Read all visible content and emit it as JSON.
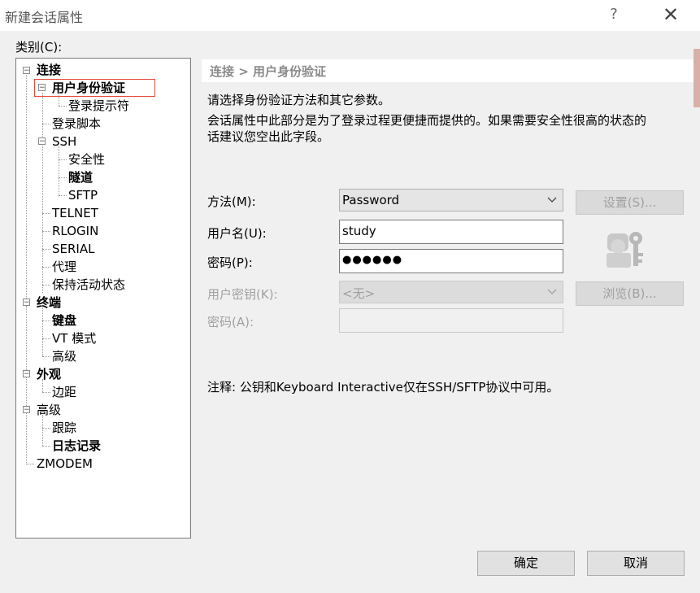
{
  "window": {
    "title": "新建会话属性",
    "help_symbol": "?",
    "close_symbol": "✕"
  },
  "category_label": "类别(C):",
  "tree": [
    {
      "label": "连接",
      "bold": true
    },
    {
      "label": "用户身份验证",
      "bold": true,
      "selected": true
    },
    {
      "label": "登录提示符",
      "bold": false
    },
    {
      "label": "登录脚本",
      "bold": false
    },
    {
      "label": "SSH",
      "bold": false
    },
    {
      "label": "安全性",
      "bold": false
    },
    {
      "label": "隧道",
      "bold": true
    },
    {
      "label": "SFTP",
      "bold": false
    },
    {
      "label": "TELNET",
      "bold": false
    },
    {
      "label": "RLOGIN",
      "bold": false
    },
    {
      "label": "SERIAL",
      "bold": false
    },
    {
      "label": "代理",
      "bold": false
    },
    {
      "label": "保持活动状态",
      "bold": false
    },
    {
      "label": "终端",
      "bold": true
    },
    {
      "label": "键盘",
      "bold": true
    },
    {
      "label": "VT 模式",
      "bold": false
    },
    {
      "label": "高级",
      "bold": false
    },
    {
      "label": "外观",
      "bold": true
    },
    {
      "label": "边距",
      "bold": false
    },
    {
      "label": "高级",
      "bold": false
    },
    {
      "label": "跟踪",
      "bold": false
    },
    {
      "label": "日志记录",
      "bold": true
    },
    {
      "label": "ZMODEM",
      "bold": false
    }
  ],
  "section_title": "连接 > 用户身份验证",
  "description": {
    "line1": "请选择身份验证方法和其它参数。",
    "line2": "会话属性中此部分是为了登录过程更便捷而提供的。如果需要安全性很高的状态的",
    "line3": "话建议您空出此字段。"
  },
  "form": {
    "method_label": "方法(M):",
    "method_value": "Password",
    "settings_button": "设置(S)...",
    "username_label": "用户名(U):",
    "username_value": "study",
    "password_label": "密码(P):",
    "password_value": "●●●●●●",
    "user_key_label": "用户密钥(K):",
    "user_key_value": "<无>",
    "browse_button": "浏览(B)...",
    "passphrase_label": "密码(A):",
    "passphrase_value": ""
  },
  "note": "注释: 公钥和Keyboard Interactive仅在SSH/SFTP协议中可用。",
  "buttons": {
    "ok": "确定",
    "cancel": "取消"
  },
  "colors": {
    "selection_outline": "#e8483b",
    "disabled_text": "#a0a0a0",
    "header_text": "#8a8a8a"
  }
}
